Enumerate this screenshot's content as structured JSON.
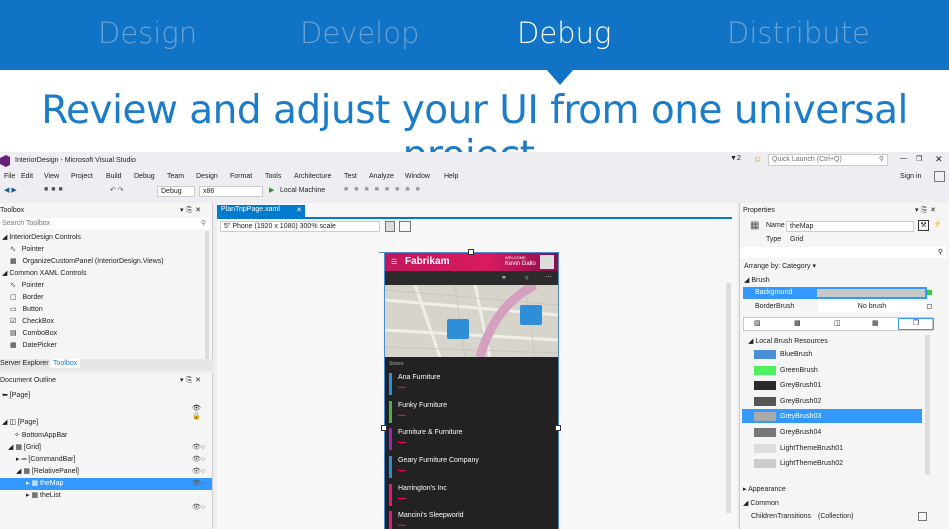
{
  "steps": {
    "s1": "Design",
    "s2": "Develop",
    "s3": "Debug",
    "s4": "Distribute"
  },
  "headline": "Review and adjust your UI from one universal project.",
  "window": {
    "title": "InteriorDesign - Microsoft Visual Studio",
    "notifications": "2",
    "quick_launch": "Quick Launch (Ctrl+Q)",
    "sign_in": "Sign in"
  },
  "menu": {
    "m1": "File",
    "m2": "Edit",
    "m3": "View",
    "m4": "Project",
    "m5": "Build",
    "m6": "Debug",
    "m7": "Team",
    "m8": "Design",
    "m9": "Format",
    "m10": "Tools",
    "m11": "Architecture",
    "m12": "Test",
    "m13": "Analyze",
    "m14": "Window",
    "m15": "Help"
  },
  "toolbar": {
    "config": "Debug",
    "platform": "x86",
    "run": "Local Machine"
  },
  "toolbox": {
    "title": "Toolbox",
    "search": "Search Toolbox",
    "items": {
      "i1": "InteriorDesign Controls",
      "i2": "Pointer",
      "i3": "OrganizeCustomPanel (InteriorDesign.Views)",
      "i4": "Common XAML Controls",
      "i5": "Pointer",
      "i6": "Border",
      "i7": "Button",
      "i8": "CheckBox",
      "i9": "ComboBox",
      "i10": "DatePicker"
    },
    "tab1": "Server Explorer",
    "tab2": "Toolbox"
  },
  "outline": {
    "title": "Document Outline",
    "items": {
      "o1": "[Page]",
      "o2": "[Page]",
      "o3": "BottomAppBar",
      "o4": "[Grid]",
      "o5": "[CommandBar]",
      "o6": "[RelativePanel]",
      "o7": "theMap",
      "o8": "theList"
    }
  },
  "doc": {
    "tab": "PlanTripPage.xaml",
    "device": "5\" Phone (1920 x 1080) 300% scale"
  },
  "app": {
    "brand": "Fabrikam",
    "welcome": "WELCOME,",
    "user": "Kevin Gallo",
    "stores": "Stores",
    "rows": {
      "r1": "Ana Furniture",
      "r2": "Funky Furniture",
      "r3": "Furniture & Furniture",
      "r4": "Geary Furniture Company",
      "r5": "Harrington's Inc",
      "r6": "Mancini's Sleepworld"
    }
  },
  "props": {
    "title": "Properties",
    "name_label": "Name",
    "name": "theMap",
    "type_label": "Type",
    "type": "Grid",
    "arrange": "Arrange by: Category",
    "brush": "Brush",
    "bg": "Background",
    "bb": "BorderBrush",
    "nobrush": "No brush",
    "local": "Local Brush Resources",
    "res": {
      "b1": "BlueBrush",
      "b2": "GreenBrush",
      "b3": "GreyBrush01",
      "b4": "GreyBrush02",
      "b5": "GreyBrush03",
      "b6": "GreyBrush04",
      "b7": "LightThemeBrush01",
      "b8": "LightThemeBrush02"
    },
    "appearance": "Appearance",
    "common": "Common",
    "children": "ChildrenTransitions",
    "collection": "(Collection)"
  },
  "colors": {
    "header": "#1073c5",
    "accent": "#e0197a",
    "selection": "#3399ff"
  }
}
